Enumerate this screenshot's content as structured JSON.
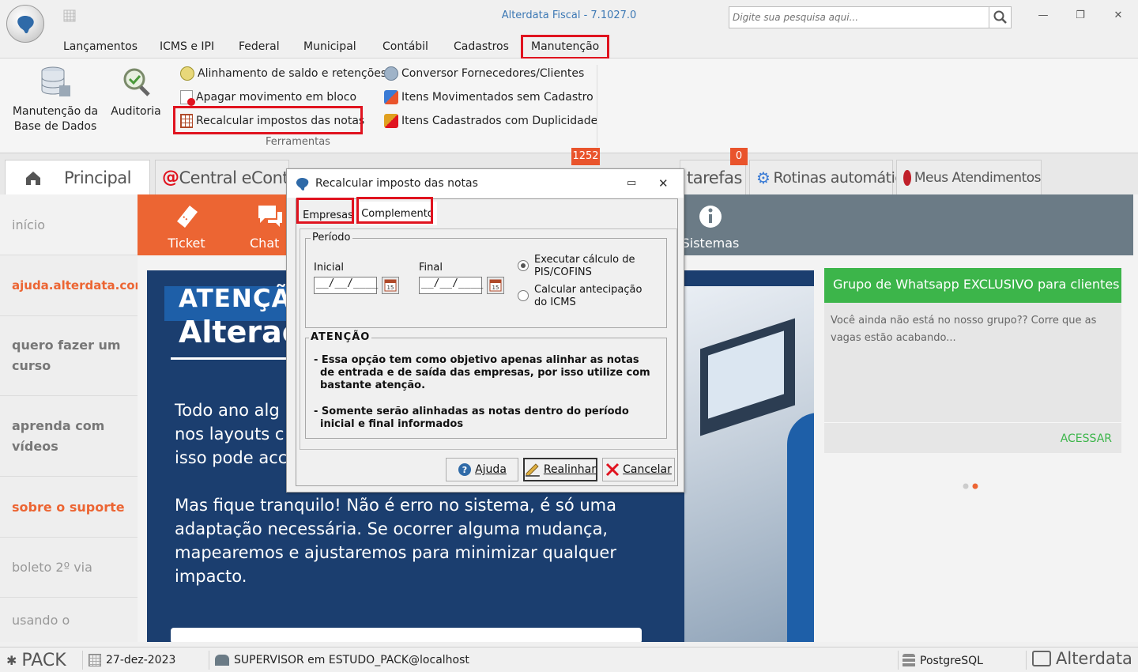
{
  "app": {
    "title": "Alterdata Fiscal - 7.1027.0",
    "search_placeholder": "Digite sua pesquisa aqui..."
  },
  "menu": [
    "Lançamentos",
    "ICMS e IPI",
    "Federal",
    "Municipal",
    "Contábil",
    "Cadastros",
    "Manutenção"
  ],
  "ribbon": {
    "big": [
      {
        "line1": "Manutenção da",
        "line2": "Base de Dados"
      },
      {
        "line1": "Auditoria",
        "line2": ""
      }
    ],
    "col1": [
      "Alinhamento de saldo e retenções",
      "Apagar movimento em bloco",
      "Recalcular impostos das notas"
    ],
    "col2": [
      "Conversor Fornecedores/Clientes",
      "Itens Movimentados sem Cadastro",
      "Itens Cadastrados com Duplicidade"
    ],
    "group_label": "Ferramentas"
  },
  "tabs": {
    "principal": "Principal",
    "econtador": "Central eContador",
    "tarefas": "tarefas",
    "rotinas": "Rotinas automáticas",
    "atendimentos": "Meus Atendimentos",
    "badge1": "1252",
    "badge2": "0"
  },
  "sidebar": [
    "início",
    "ajuda.alterdata.com.br",
    "quero fazer um curso",
    "aprenda com vídeos",
    "sobre o suporte",
    "boleto 2º via",
    "usando o"
  ],
  "nav": {
    "ticket": "Ticket",
    "chat": "Chat",
    "sistemas": "Sistemas"
  },
  "banner": {
    "h1": "ATENÇÃO",
    "h2": "Alteraç",
    "p1": [
      "Todo ano alg",
      "nos layouts c",
      "isso pode acc"
    ],
    "p2": [
      "Mas fique tranquilo! Não é erro no sistema, é só uma",
      "adaptação necessária. Se ocorrer alguma mudança,",
      "mapearemos e ajustaremos para minimizar qualquer",
      "impacto."
    ]
  },
  "card": {
    "header": "Grupo de Whatsapp EXCLUSIVO para clientes",
    "body": "Você ainda não está no nosso grupo?? Corre que as vagas estão acabando...",
    "link": "ACESSAR"
  },
  "dialog": {
    "title": "Recalcular imposto das notas",
    "tabs": [
      "Empresas",
      "Complemento"
    ],
    "periodo_legend": "Período",
    "inicial_label": "Inicial",
    "final_label": "Final",
    "inicial_value": "__/__/____",
    "final_value": "__/__/____",
    "radio1": [
      "Executar cálculo de",
      "PIS/COFINS"
    ],
    "radio2": [
      "Calcular antecipação",
      "do ICMS"
    ],
    "atencao_legend": "ATENÇÃO",
    "atencao_lines1": [
      "- Essa opção tem como objetivo apenas alinhar as notas",
      "  de entrada e de saída das empresas, por isso utilize com",
      "  bastante atenção."
    ],
    "atencao_lines2": [
      "- Somente serão alinhadas as notas dentro do período",
      "  inicial e final informados"
    ],
    "buttons": {
      "help": "Ajuda",
      "realign": "Realinhar",
      "cancel": "Cancelar"
    }
  },
  "status": {
    "pack": "PACK",
    "date": "27-dez-2023",
    "user": "SUPERVISOR em ESTUDO_PACK@localhost",
    "db": "PostgreSQL",
    "brand": "Alterdata"
  },
  "colors": {
    "accent_red": "#e0131f",
    "orange": "#ec6533",
    "green": "#3cb54a",
    "navy": "#1b3e6f"
  }
}
